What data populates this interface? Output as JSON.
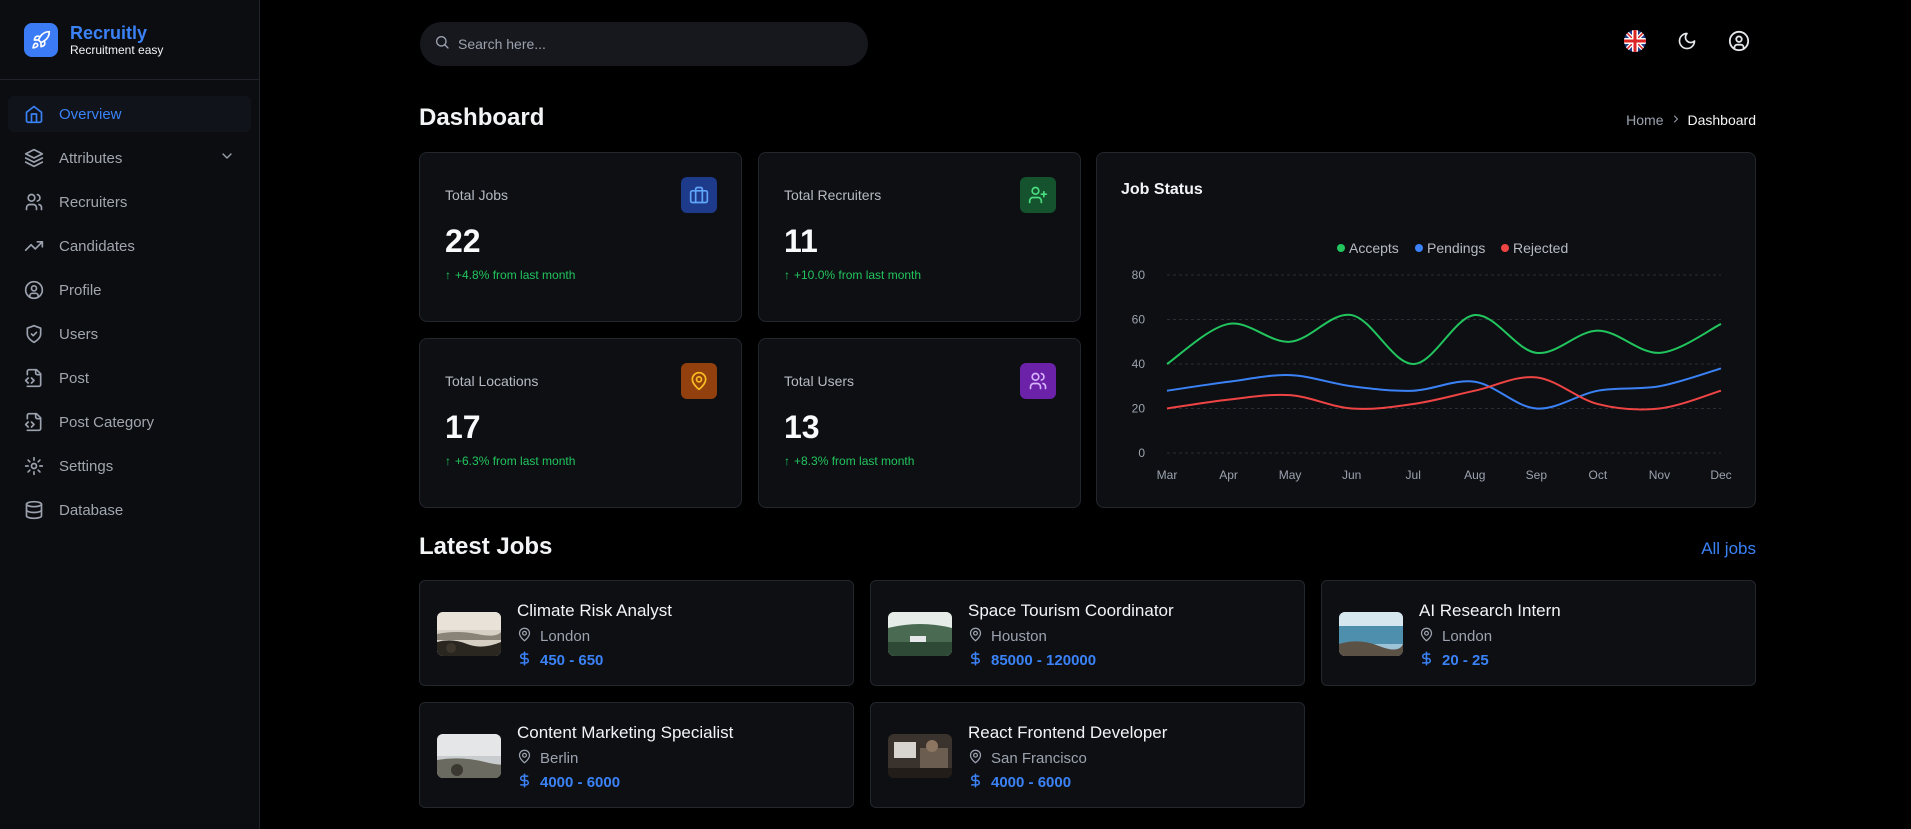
{
  "brand": {
    "name": "Recruitly",
    "tagline": "Recruitment easy"
  },
  "sidebar": {
    "items": [
      {
        "label": "Overview",
        "icon": "home-icon",
        "active": true
      },
      {
        "label": "Attributes",
        "icon": "layers-icon",
        "expandable": true
      },
      {
        "label": "Recruiters",
        "icon": "users-icon"
      },
      {
        "label": "Candidates",
        "icon": "trending-up-icon"
      },
      {
        "label": "Profile",
        "icon": "user-circle-icon"
      },
      {
        "label": "Users",
        "icon": "shield-check-icon"
      },
      {
        "label": "Post",
        "icon": "file-code-icon"
      },
      {
        "label": "Post Category",
        "icon": "file-code-icon"
      },
      {
        "label": "Settings",
        "icon": "gear-icon"
      },
      {
        "label": "Database",
        "icon": "database-icon"
      }
    ]
  },
  "search": {
    "placeholder": "Search here..."
  },
  "topbar": {
    "icons": [
      "uk-flag-icon",
      "moon-icon",
      "user-circle-icon"
    ]
  },
  "page": {
    "title": "Dashboard"
  },
  "breadcrumb": {
    "home": "Home",
    "current": "Dashboard"
  },
  "stats": [
    {
      "label": "Total Jobs",
      "value": "22",
      "change": "+4.8% from last month",
      "icon": "briefcase-icon",
      "color": "#3b82f6"
    },
    {
      "label": "Total Recruiters",
      "value": "11",
      "change": "+10.0% from last month",
      "icon": "user-plus-icon",
      "color": "#22c55e"
    },
    {
      "label": "Total Locations",
      "value": "17",
      "change": "+6.3% from last month",
      "icon": "map-pin-icon",
      "color": "#f59e0b"
    },
    {
      "label": "Total Users",
      "value": "13",
      "change": "+8.3% from last month",
      "icon": "users-icon",
      "color": "#a855f7"
    }
  ],
  "chart_card": {
    "title": "Job Status"
  },
  "chart_data": {
    "type": "line",
    "title": "Job Status",
    "categories": [
      "Mar",
      "Apr",
      "May",
      "Jun",
      "Jul",
      "Aug",
      "Sep",
      "Oct",
      "Nov",
      "Dec"
    ],
    "ylim": [
      0,
      80
    ],
    "yticks": [
      0,
      20,
      40,
      60,
      80
    ],
    "grid": true,
    "legend": "top-center",
    "series": [
      {
        "name": "Accepts",
        "color": "#22c55e",
        "values": [
          40,
          58,
          50,
          62,
          40,
          62,
          45,
          55,
          45,
          58
        ]
      },
      {
        "name": "Pendings",
        "color": "#3b82f6",
        "values": [
          28,
          32,
          35,
          30,
          28,
          32,
          20,
          28,
          30,
          38
        ]
      },
      {
        "name": "Rejected",
        "color": "#ef4444",
        "values": [
          20,
          24,
          26,
          20,
          22,
          28,
          34,
          22,
          20,
          28
        ]
      }
    ]
  },
  "latest_jobs": {
    "title": "Latest Jobs",
    "all_label": "All jobs",
    "items": [
      {
        "title": "Climate Risk Analyst",
        "location": "London",
        "salary": "450 - 650"
      },
      {
        "title": "Space Tourism Coordinator",
        "location": "Houston",
        "salary": "85000 - 120000"
      },
      {
        "title": "AI Research Intern",
        "location": "London",
        "salary": "20 - 25"
      },
      {
        "title": "Content Marketing Specialist",
        "location": "Berlin",
        "salary": "4000 - 6000"
      },
      {
        "title": "React Frontend Developer",
        "location": "San Francisco",
        "salary": "4000 - 6000"
      }
    ]
  }
}
